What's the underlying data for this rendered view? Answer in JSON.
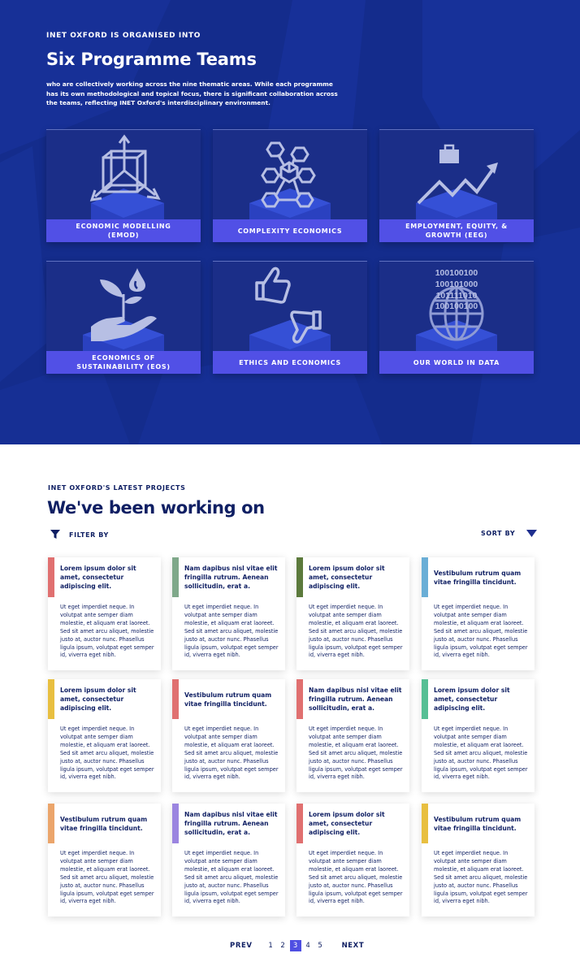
{
  "hero": {
    "eyebrow": "INET OXFORD IS ORGANISED INTO",
    "title": "Six Programme Teams",
    "description": "who are collectively working across the nine thematic areas. While each programme has its own methodological and topical focus, there is significant collaboration across the teams, reflecting INET Oxford's interdisciplinary environment.",
    "teams": [
      {
        "label": "ECONOMIC MODELLING (EMOD)",
        "icon": "cube-axes-icon"
      },
      {
        "label": "COMPLEXITY ECONOMICS",
        "icon": "hexagon-network-icon"
      },
      {
        "label": "EMPLOYMENT, EQUITY, & GROWTH (EEG)",
        "icon": "briefcase-growth-icon"
      },
      {
        "label": "ECONOMICS OF SUSTAINABILITY (EOS)",
        "icon": "hand-plant-icon"
      },
      {
        "label": "ETHICS AND ECONOMICS",
        "icon": "thumbs-up-down-icon"
      },
      {
        "label": "OUR WORLD IN DATA",
        "icon": "globe-binary-icon",
        "binary": [
          "100100100",
          "100101000",
          "101111010",
          "100100100"
        ]
      }
    ]
  },
  "projects": {
    "eyebrow": "INET OXFORD'S LATEST PROJECTS",
    "title": "We've been working on",
    "filter_label": "FILTER BY",
    "sort_label": "SORT BY",
    "cards": [
      {
        "title": "Lorem ipsum dolor sit amet, consectetur adipiscing elit.",
        "color": "#e07070"
      },
      {
        "title": "Nam dapibus nisl vitae elit fringilla rutrum. Aenean sollicitudin, erat a.",
        "color": "#7fa88a"
      },
      {
        "title": "Lorem ipsum dolor sit amet, consectetur adipiscing elit.",
        "color": "#5c7a3c"
      },
      {
        "title": "Vestibulum rutrum quam vitae fringilla tincidunt.",
        "color": "#6aaed6"
      },
      {
        "title": "Lorem ipsum dolor sit amet, consectetur adipiscing elit.",
        "color": "#e8bf40"
      },
      {
        "title": "Vestibulum rutrum quam vitae fringilla tincidunt.",
        "color": "#e07070"
      },
      {
        "title": "Nam dapibus nisl vitae elit fringilla rutrum. Aenean sollicitudin, erat a.",
        "color": "#e07070"
      },
      {
        "title": "Lorem ipsum dolor sit amet, consectetur adipiscing elit.",
        "color": "#57bf95"
      },
      {
        "title": "Vestibulum rutrum quam vitae fringilla tincidunt.",
        "color": "#eba56b"
      },
      {
        "title": "Nam dapibus nisl vitae elit fringilla rutrum. Aenean sollicitudin, erat a.",
        "color": "#9b85e0"
      },
      {
        "title": "Lorem ipsum dolor sit amet, consectetur adipiscing elit.",
        "color": "#e07070"
      },
      {
        "title": "Vestibulum rutrum quam vitae fringilla tincidunt.",
        "color": "#e8bf40"
      }
    ],
    "card_body": "Ut eget imperdiet neque. In volutpat ante semper diam molestie, et aliquam erat laoreet. Sed sit amet arcu aliquet, molestie justo at, auctor nunc. Phasellus ligula ipsum, volutpat eget semper id, viverra eget nibh."
  },
  "pagination": {
    "prev": "PREV",
    "next": "NEXT",
    "pages": [
      "1",
      "2",
      "3",
      "4",
      "5"
    ],
    "current": "3"
  },
  "colors": {
    "hero_bg": "#142c8c",
    "team_label_bg": "#5150e6",
    "navy_text": "#0f1f63",
    "pager_active": "#4f4fe2"
  }
}
